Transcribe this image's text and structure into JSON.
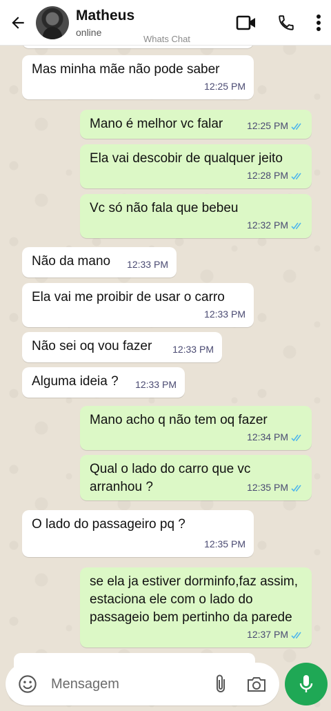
{
  "header": {
    "contact_name": "Matheus",
    "status": "online",
    "watermark": "Whats Chat"
  },
  "messages": [
    {
      "dir": "in",
      "text": "Mas minha mãe não pode saber",
      "time": "12:25 PM"
    },
    {
      "dir": "out",
      "text": "Mano é melhor vc falar",
      "time": "12:25 PM"
    },
    {
      "dir": "out",
      "text": "Ela vai descobir de qualquer jeito",
      "time": "12:28 PM"
    },
    {
      "dir": "out",
      "text": "Vc só não fala que bebeu",
      "time": "12:32 PM"
    },
    {
      "dir": "in",
      "text": "Não da mano",
      "time": "12:33 PM"
    },
    {
      "dir": "in",
      "text": "Ela vai me proibir de usar o carro",
      "time": "12:33 PM"
    },
    {
      "dir": "in",
      "text": "Não sei oq vou fazer",
      "time": "12:33 PM"
    },
    {
      "dir": "in",
      "text": "Alguma ideia ?",
      "time": "12:33 PM"
    },
    {
      "dir": "out",
      "text": "Mano acho q não tem oq fazer",
      "time": "12:34 PM"
    },
    {
      "dir": "out",
      "text": "Qual o lado do carro que vc arranhou ?",
      "time": "12:35 PM"
    },
    {
      "dir": "in",
      "text": "O lado do passageiro pq ?",
      "time": "12:35 PM"
    },
    {
      "dir": "out",
      "text": "se ela ja estiver dorminfo,faz assim, estaciona ele com o lado do passageio bem pertinho da parede",
      "time": "12:37 PM"
    }
  ],
  "input": {
    "placeholder": "Mensagem"
  },
  "colors": {
    "incoming_bubble": "#ffffff",
    "outgoing_bubble": "#dcf8c6",
    "read_ticks": "#4fb6ec",
    "mic_button": "#1fa855"
  },
  "icons": [
    "back-arrow-icon",
    "video-call-icon",
    "phone-icon",
    "more-options-icon",
    "emoji-icon",
    "attach-icon",
    "camera-icon",
    "mic-icon",
    "read-ticks-icon"
  ]
}
